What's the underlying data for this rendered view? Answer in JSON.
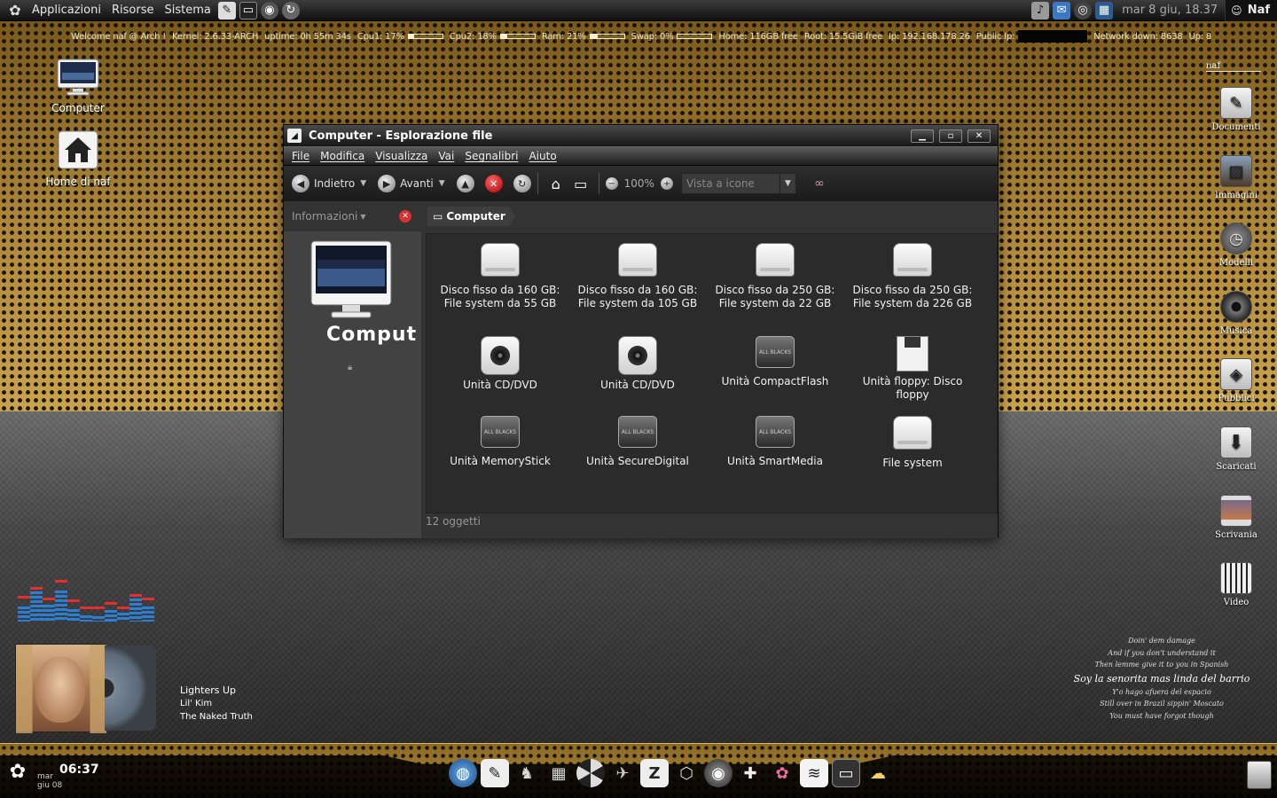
{
  "top_panel": {
    "menus": [
      "Applicazioni",
      "Risorse",
      "Sistema"
    ],
    "clock": "mar  8 giu, 18.37",
    "user": "Naf"
  },
  "conky": {
    "welcome": "Welcome naf @ Arch !",
    "kernel": "Kernel: 2.6.33-ARCH",
    "uptime": "uptime: 0h 55m 34s",
    "cpu1": "Cpu1: 17%",
    "cpu1_pct": 17,
    "cpu2": "Cpu2: 18%",
    "cpu2_pct": 18,
    "ram": "Ram: 21%",
    "ram_pct": 21,
    "swap": "Swap: 0%",
    "swap_pct": 0,
    "home": "Home: 116GB free",
    "root": "Root: 15.5GiB free",
    "ip": "Ip: 192.168.178.26",
    "public_ip": "Public Ip:",
    "network": "Network down: 8638",
    "up": "Up: 8"
  },
  "desktop_left": [
    {
      "label": "Computer"
    },
    {
      "label": "Home di naf"
    }
  ],
  "desktop_right": {
    "header": "naf",
    "items": [
      {
        "label": "Documenti",
        "icon": "document-icon"
      },
      {
        "label": "Immagini",
        "icon": "pictures-icon"
      },
      {
        "label": "Modelli",
        "icon": "templates-icon"
      },
      {
        "label": "Musica",
        "icon": "music-icon"
      },
      {
        "label": "Pubblici",
        "icon": "public-icon"
      },
      {
        "label": "Scaricati",
        "icon": "download-icon"
      },
      {
        "label": "Scrivania",
        "icon": "desktop-icon"
      },
      {
        "label": "Video",
        "icon": "video-icon"
      }
    ]
  },
  "window": {
    "title": "Computer - Esplorazione file",
    "menu": [
      "File",
      "Modifica",
      "Visualizza",
      "Vai",
      "Segnalibri",
      "Aiuto"
    ],
    "toolbar": {
      "back": "Indietro",
      "forward": "Avanti",
      "zoom": "100%",
      "view": "Vista a icone"
    },
    "sidebar": {
      "mode": "Informazioni",
      "title": "Comput"
    },
    "path": "Computer",
    "items": [
      {
        "label": "Disco fisso da 160 GB: File system da 55 GB",
        "type": "hdd"
      },
      {
        "label": "Disco fisso da 160 GB: File system da 105 GB",
        "type": "hdd"
      },
      {
        "label": "Disco fisso da 250 GB: File system da 22 GB",
        "type": "hdd"
      },
      {
        "label": "Disco fisso da 250 GB: File system da 226 GB",
        "type": "hdd"
      },
      {
        "label": "Unità CD/DVD",
        "type": "cd"
      },
      {
        "label": "Unità CD/DVD",
        "type": "cd"
      },
      {
        "label": "Unità CompactFlash",
        "type": "card"
      },
      {
        "label": "Unità floppy: Disco floppy",
        "type": "floppy"
      },
      {
        "label": "Unità MemoryStick",
        "type": "card"
      },
      {
        "label": "Unità SecureDigital",
        "type": "card"
      },
      {
        "label": "Unità SmartMedia",
        "type": "card"
      },
      {
        "label": "File system",
        "type": "hdd"
      }
    ],
    "status": "12 oggetti"
  },
  "now_playing": {
    "title": "Lighters Up",
    "artist": "Lil' Kim",
    "album": "The Naked Truth"
  },
  "spectrum": {
    "levels": [
      0.35,
      0.7,
      0.4,
      0.72,
      0.3,
      0.15,
      0.12,
      0.28,
      0.2,
      0.55,
      0.35
    ],
    "peaks": [
      0.55,
      0.75,
      0.5,
      0.92,
      0.45,
      0.3,
      0.3,
      0.4,
      0.3,
      0.58,
      0.5
    ]
  },
  "lyrics": {
    "lines": [
      "Doin' dem damage",
      "And if you don't understand it",
      "Then lemme give it to you in Spanish"
    ],
    "current": "Soy la senorita mas linda del barrio",
    "after": [
      "Y'o hago afuera del espacio",
      "Still over in Brazil sippin' Moscato",
      "You must have forgot though"
    ]
  },
  "dock": {
    "time": "06:37",
    "day": "mar",
    "date": "giu 08"
  }
}
